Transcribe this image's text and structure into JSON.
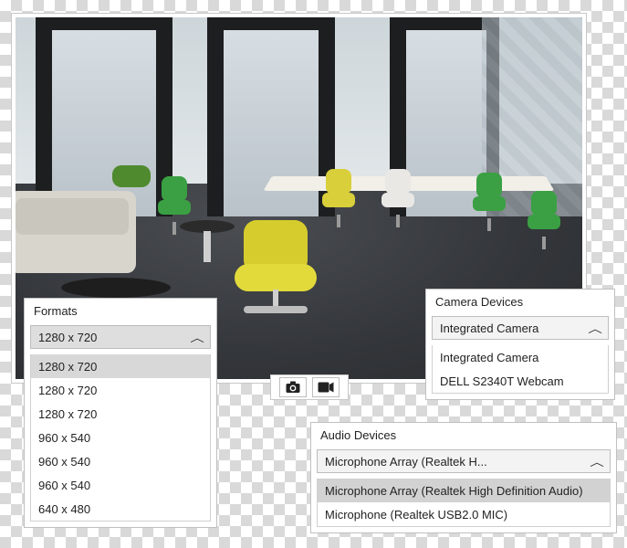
{
  "toolbar": {
    "photo_icon": "camera-icon",
    "video_icon": "video-icon"
  },
  "formats": {
    "title": "Formats",
    "selected": "1280 x 720",
    "options": [
      "1280 x 720",
      "1280 x 720",
      "1280 x 720",
      "960 x 540",
      "960 x 540",
      "960 x 540",
      "640 x 480"
    ]
  },
  "camera": {
    "title": "Camera Devices",
    "selected": "Integrated Camera",
    "options": [
      "Integrated Camera",
      "DELL S2340T Webcam"
    ]
  },
  "audio": {
    "title": "Audio Devices",
    "selected": "Microphone Array (Realtek H...",
    "options": [
      "Microphone Array (Realtek High Definition Audio)",
      "Microphone (Realtek USB2.0 MIC)"
    ]
  }
}
